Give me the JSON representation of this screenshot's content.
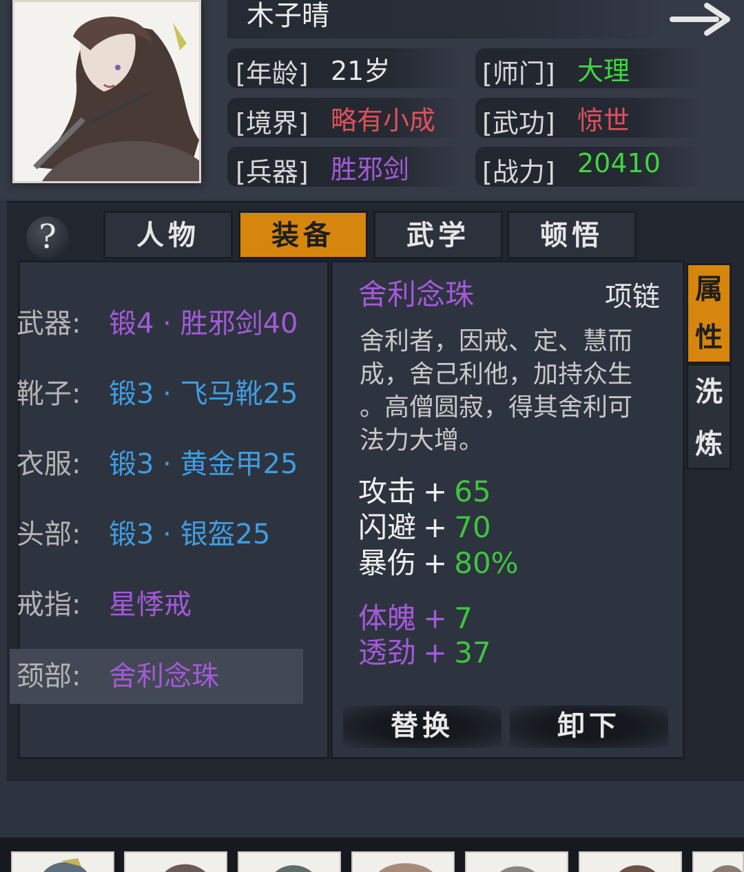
{
  "character": {
    "name": "木子晴",
    "info": [
      {
        "label": "[年龄]",
        "value": "21岁",
        "color": "#e8e8e8"
      },
      {
        "label": "[师门]",
        "value": "大理",
        "color": "#3fd63f"
      },
      {
        "label": "[境界]",
        "value": "略有小成",
        "color": "#e0505a"
      },
      {
        "label": "[武功]",
        "value": "惊世",
        "color": "#e0505a"
      },
      {
        "label": "[兵器]",
        "value": "胜邪剑",
        "color": "#a35ad8"
      },
      {
        "label": "[战力]",
        "value": "20410",
        "color": "#3fd63f"
      }
    ]
  },
  "help_label": "?",
  "tabs": [
    {
      "label": "人物",
      "active": false
    },
    {
      "label": "装备",
      "active": true
    },
    {
      "label": "武学",
      "active": false
    },
    {
      "label": "顿悟",
      "active": false
    }
  ],
  "equipment": [
    {
      "label": "武器:",
      "value": "锻4 · 胜邪剑40",
      "color": "#a35ad8"
    },
    {
      "label": "靴子:",
      "value": "锻3 · 飞马靴25",
      "color": "#3e9ee0"
    },
    {
      "label": "衣服:",
      "value": "锻3 · 黄金甲25",
      "color": "#3e9ee0"
    },
    {
      "label": "头部:",
      "value": "锻3 · 银盔25",
      "color": "#3e9ee0"
    },
    {
      "label": "戒指:",
      "value": "星悸戒",
      "color": "#a35ad8"
    },
    {
      "label": "颈部:",
      "value": "舍利念珠",
      "color": "#a35ad8",
      "selected": true
    }
  ],
  "detail": {
    "name": "舍利念珠",
    "type": "项链",
    "description": [
      "舍利者，因戒、定、慧而",
      "成，舍己利他，加持众生",
      "。高僧圆寂，得其舍利可",
      "法力大增。"
    ],
    "base_stats": [
      {
        "name": "攻击",
        "plus": "+",
        "value": "65"
      },
      {
        "name": "闪避",
        "plus": "+",
        "value": "70"
      },
      {
        "name": "暴伤",
        "plus": "+",
        "value": "80%"
      }
    ],
    "bonus_stats": [
      {
        "name": "体魄",
        "plus": "+",
        "value": "7"
      },
      {
        "name": "透劲",
        "plus": "+",
        "value": "37"
      }
    ],
    "replace_label": "替换",
    "unequip_label": "卸下"
  },
  "side_tabs": [
    {
      "label": "属性",
      "active": true
    },
    {
      "label": "洗炼",
      "active": false
    }
  ],
  "colors": {
    "accent": "#d6860c",
    "purple": "#a35ad8",
    "blue": "#3e9ee0",
    "green": "#3fc43f",
    "red": "#e0505a"
  },
  "icons": {
    "next": "arrow-right-icon",
    "help": "question-icon"
  }
}
